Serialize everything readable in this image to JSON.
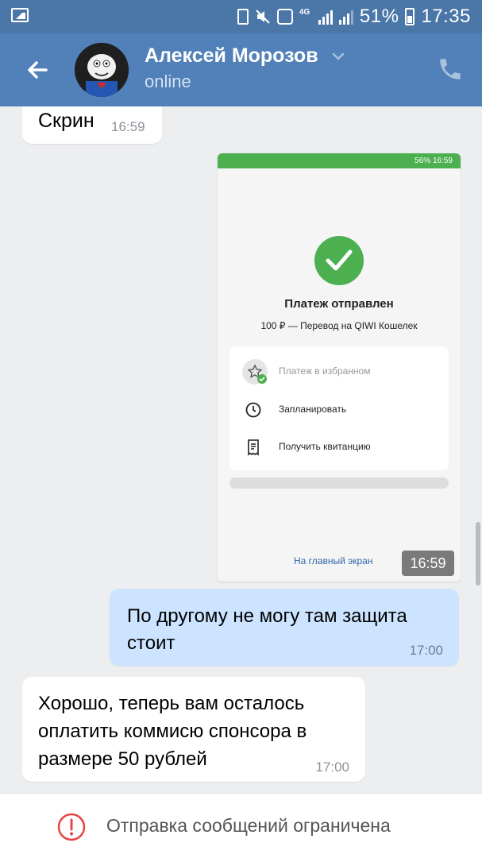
{
  "status_bar": {
    "battery_percent": "51%",
    "time": "17:35",
    "network": "4G"
  },
  "header": {
    "contact_name": "Алексей Морозов",
    "status": "online"
  },
  "messages": [
    {
      "direction": "in",
      "text": "Скрин",
      "time": "16:59"
    },
    {
      "direction": "in",
      "type": "image",
      "time": "16:59"
    },
    {
      "direction": "out",
      "text": "По другому не могу там защита стоит",
      "time": "17:00"
    },
    {
      "direction": "in",
      "text": "Хорошо, теперь вам осталось оплатить коммисю спонсора в размере 50 рублей",
      "time": "17:00"
    }
  ],
  "screenshot": {
    "status_text": "56% 16:59",
    "title": "Платеж отправлен",
    "subtitle": "100 ₽ — Перевод на QIWI Кошелек",
    "actions": [
      "Платеж в избранном",
      "Запланировать",
      "Получить квитанцию"
    ],
    "home_link": "На главный экран",
    "accent": "#4caf50"
  },
  "footer": {
    "notice": "Отправка сообщений ограничена"
  },
  "colors": {
    "header": "#5181b8",
    "status_bar": "#4a76a8",
    "outgoing_bubble": "#cce4ff",
    "background": "#edeef0"
  }
}
